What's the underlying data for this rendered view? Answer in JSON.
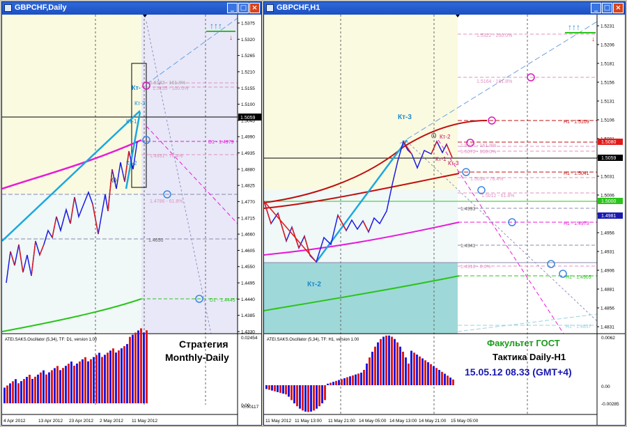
{
  "left_window": {
    "title": "GBPCHF,Daily",
    "buttons": [
      "_",
      "□",
      "×"
    ],
    "price_labels": [
      "1.5375",
      "1.5320",
      "1.5265",
      "1.5210",
      "1.5155",
      "1.5100",
      "1.5045",
      "1.4990",
      "1.4935",
      "1.4880",
      "1.4825",
      "1.4770",
      "1.4715",
      "1.4660",
      "1.4605",
      "1.4550",
      "1.4495",
      "1.4440",
      "1.4385",
      "1.4330"
    ],
    "current_price": "1.5059",
    "osc_scale": [
      "0.02454",
      "-0.00117"
    ],
    "osc_zero_label": "0.00",
    "date_labels": [
      "4 Apr 2012",
      "13 Apr 2012",
      "23 Apr 2012",
      "2 May 2012",
      "11 May 2012"
    ],
    "osc_title": "ATEI.SAKS.Oscillator (5,34), TF: D1, version 1.00",
    "strategy_line1": "Стратегия",
    "strategy_line2": "Monthly-Daily",
    "annotations": {
      "fib_1618": "1.5182 - 161.8%",
      "fib_100": "1.5155 - 100.0%",
      "d1_level": "D1 - 1.4979",
      "fib_764": "1.4931 - 76.4%",
      "fib_618": "1.4786 - 61.8%",
      "level_1": "1.4650",
      "d1_low": "D1 - 1.4445",
      "kt_main": "Кт-",
      "kt3": "Кт-3",
      "kt1": "Кт-1",
      "kt2": "Кт-2",
      "wave": "(i)"
    },
    "arrows": "↑↑↑",
    "down_arrow": "↓"
  },
  "right_window": {
    "title": "GBPCHF,H1",
    "buttons": [
      "_",
      "□",
      "×"
    ],
    "price_labels": [
      "1.5231",
      "1.5206",
      "1.5181",
      "1.5156",
      "1.5131",
      "1.5106",
      "1.5081",
      "1.5056",
      "1.5031",
      "1.5006",
      "1.4981",
      "1.4956",
      "1.4931",
      "1.4906",
      "1.4881",
      "1.4856",
      "1.4831"
    ],
    "current_price": "1.5059",
    "tag_1": "1.5080",
    "tag_2": "1.5000",
    "tag_3": "1.4981",
    "osc_scale": [
      "0.0062",
      "0.00",
      "-0.00285"
    ],
    "date_labels": [
      "11 May 2012",
      "11 May 13:00",
      "11 May 21:00",
      "14 May 05:00",
      "14 May 13:00",
      "14 May 21:00",
      "15 May 05:00"
    ],
    "osc_title": "ATEI.SAKS.Oscillator (5,34), TF: H1, version 1.00",
    "faculty": "Факультет ГОСТ",
    "tactic": "Тактика Daily-H1",
    "datetime": "15.05.12   08.33 (GMT+4)",
    "annotations": {
      "fib_2000": "1.5322 - 200.0%",
      "fib_1618": "1.5164 - 161.8%",
      "h1_5109": "H1 - 1.5109",
      "fib_1618b": "1.5077 - 161.8%",
      "fib_100": "1.5070 - 100.0%",
      "h1_5041": "H1 - 1.5041",
      "fib_764": "1.5034 - 76.4%",
      "fib_618": "1.5012 - 61.8%",
      "level_4993": "1.4993",
      "h1_4973": "H1 - 1.4973",
      "level_4941": "1.4941",
      "fib_0": "1.4918 - 0.0%",
      "h1_4905": "H1 - 1.4905",
      "h1_4837": "H1 - 1.4837",
      "kt3": "Кт-3",
      "kt2_big": "Кт-2",
      "kt2": "Кт-2",
      "kt1": "Кт-1",
      "kt3b": "Кт-3",
      "wave": "(i)"
    },
    "arrows": "↑↑↑",
    "down_arrow": "↓"
  },
  "colors": {
    "title_bar": "#1c4fc4",
    "up_bar": "#1a1ae0",
    "down_bar": "#e01a1a",
    "ma_magenta": "#e81ad8",
    "ma_green": "#2ac41a",
    "ma_red": "#c01010",
    "kt_cyan": "#1aa8e0",
    "circle_blue": "#3a86e0",
    "circle_magenta": "#d81ab8",
    "text_green": "#1a9a1a",
    "text_blue": "#1a1ab0",
    "teal_zone": "#9fd8d8"
  }
}
